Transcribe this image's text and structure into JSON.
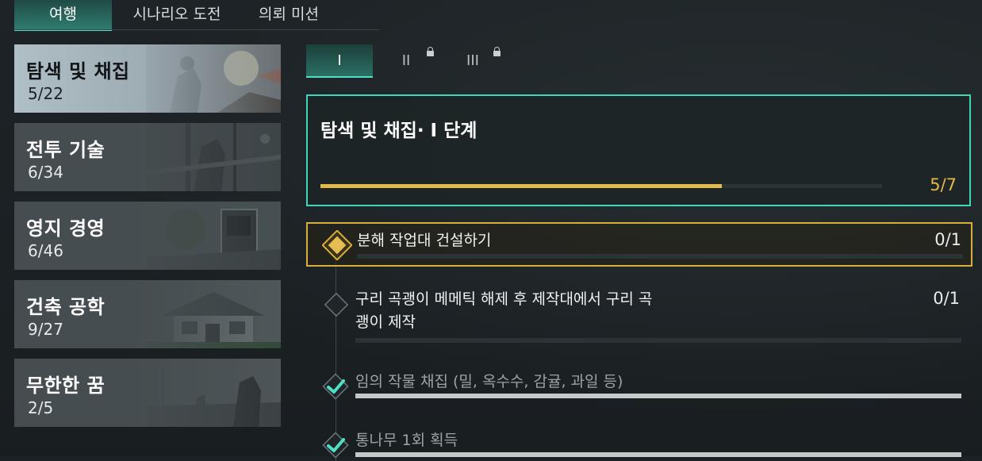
{
  "top_tabs": [
    {
      "label": "여행",
      "active": true
    },
    {
      "label": "시나리오 도전",
      "active": false
    },
    {
      "label": "의뢰 미션",
      "active": false
    }
  ],
  "categories": [
    {
      "name": "탐색 및 채집",
      "count": "5/22",
      "active": true
    },
    {
      "name": "전투 기술",
      "count": "6/34",
      "active": false
    },
    {
      "name": "영지 경영",
      "count": "6/46",
      "active": false
    },
    {
      "name": "건축 공학",
      "count": "9/27",
      "active": false
    },
    {
      "name": "무한한 꿈",
      "count": "2/5",
      "active": false
    }
  ],
  "stage_tabs": [
    {
      "label": "I",
      "locked": false,
      "active": true
    },
    {
      "label": "II",
      "locked": true,
      "active": false
    },
    {
      "label": "III",
      "locked": true,
      "active": false
    }
  ],
  "summary": {
    "title": "탐색 및 채집· I 단계",
    "progress_text": "5/7",
    "progress_fraction": 0.714
  },
  "tasks": [
    {
      "label": "분해 작업대 건설하기",
      "progress": "0/1",
      "state": "current",
      "fill": 0.0
    },
    {
      "label": "구리 곡괭이 메메틱 해제 후 제작대에서 구리 곡",
      "label_line2": "괭이 제작",
      "progress": "0/1",
      "state": "pending",
      "fill": 0.0
    },
    {
      "label": "임의 작물 채집 (밀, 옥수수, 감귤, 과일 등)",
      "progress": "",
      "state": "done",
      "fill": 1.0
    },
    {
      "label": "통나무 1회 획득",
      "progress": "",
      "state": "done",
      "fill": 1.0
    }
  ],
  "colors": {
    "accent_teal": "#4fe0c6",
    "accent_gold": "#e3b94b",
    "current_border": "#d8ae3c"
  },
  "icons": [
    "lock-icon",
    "diamond-icon",
    "check-icon"
  ]
}
